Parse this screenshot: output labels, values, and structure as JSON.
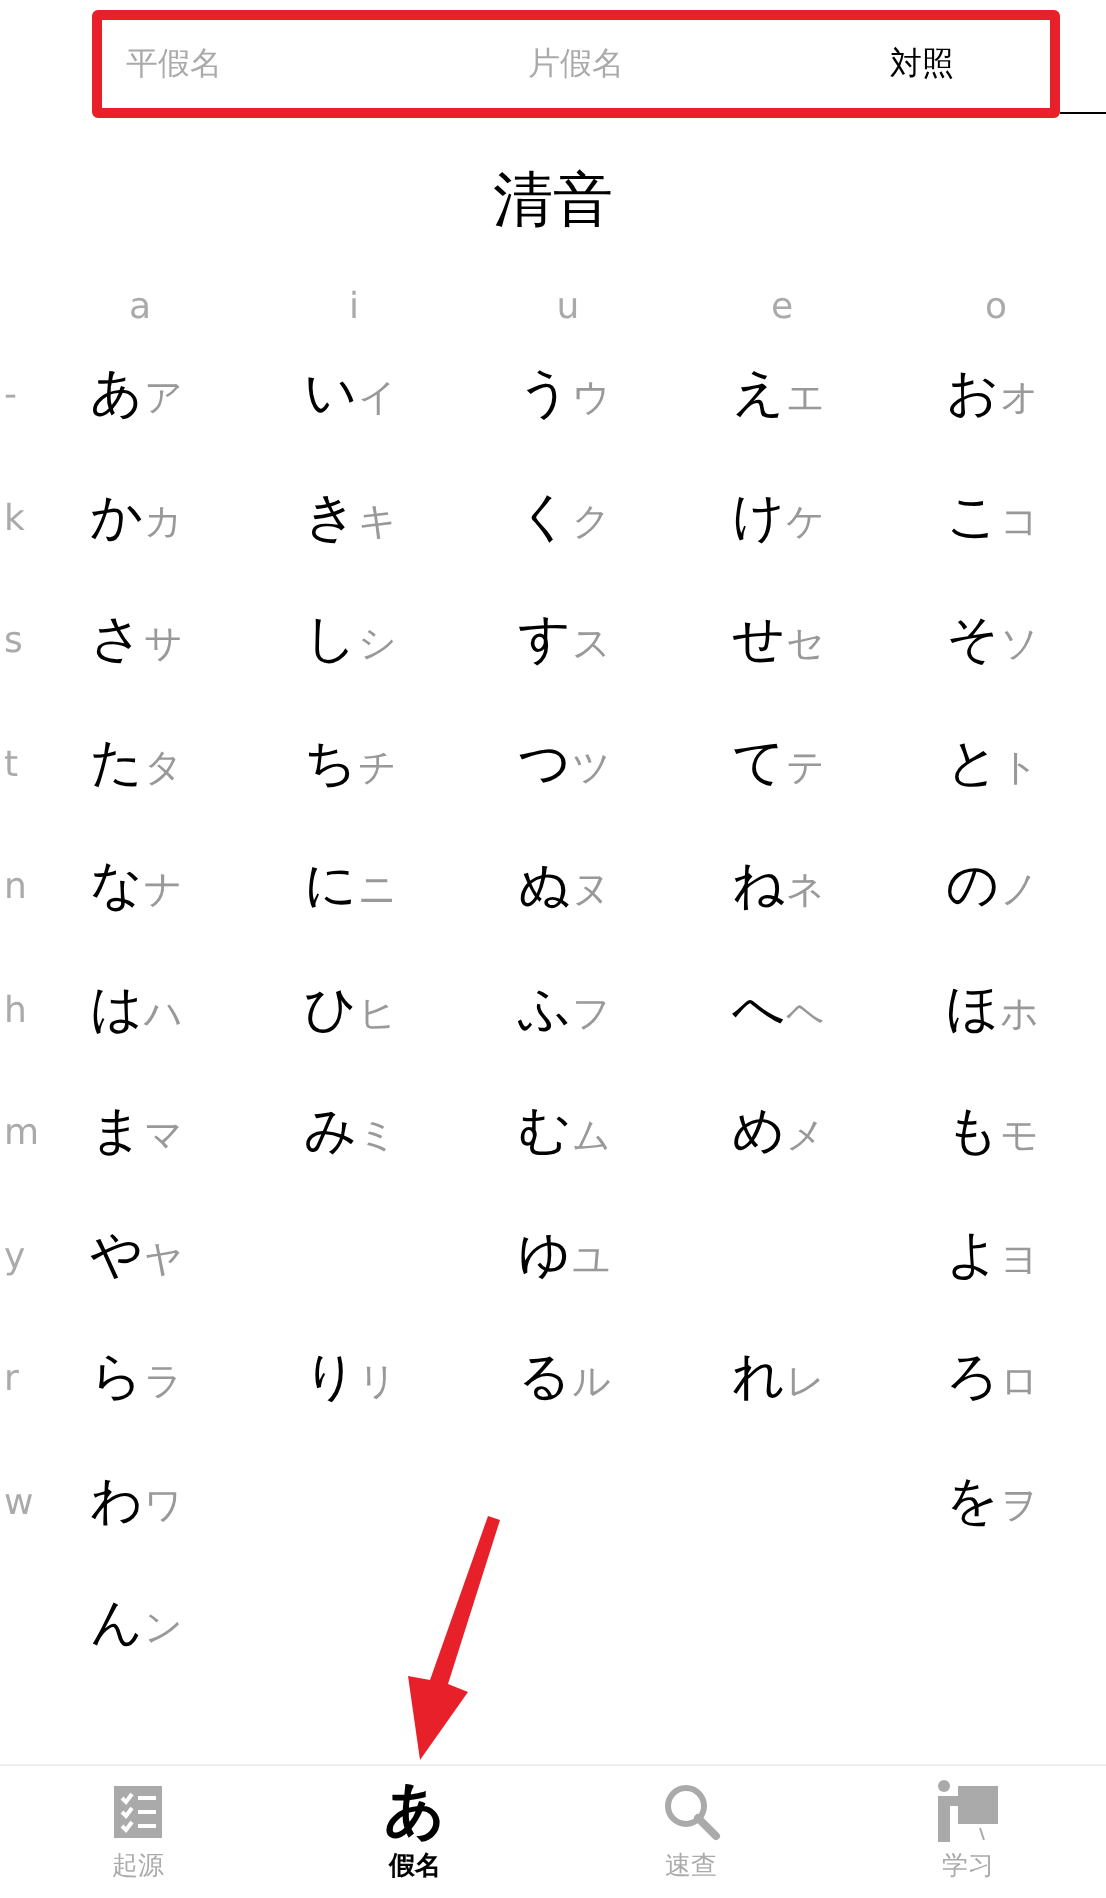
{
  "top_tabs": [
    {
      "label": "平假名",
      "selected": false
    },
    {
      "label": "片假名",
      "selected": false
    },
    {
      "label": "対照",
      "selected": true
    }
  ],
  "title": "清音",
  "vowels": [
    "a",
    "i",
    "u",
    "e",
    "o"
  ],
  "rows": [
    {
      "label": "-",
      "cells": [
        {
          "kind": "kana",
          "hiragana": "あ",
          "katakana": "ア"
        },
        {
          "kind": "kana",
          "hiragana": "い",
          "katakana": "イ"
        },
        {
          "kind": "kana",
          "hiragana": "う",
          "katakana": "ウ"
        },
        {
          "kind": "kana",
          "hiragana": "え",
          "katakana": "エ"
        },
        {
          "kind": "kana",
          "hiragana": "お",
          "katakana": "オ"
        }
      ]
    },
    {
      "label": "k",
      "cells": [
        {
          "kind": "kana",
          "hiragana": "か",
          "katakana": "カ"
        },
        {
          "kind": "kana",
          "hiragana": "き",
          "katakana": "キ"
        },
        {
          "kind": "kana",
          "hiragana": "く",
          "katakana": "ク"
        },
        {
          "kind": "kana",
          "hiragana": "け",
          "katakana": "ケ"
        },
        {
          "kind": "kana",
          "hiragana": "こ",
          "katakana": "コ"
        }
      ]
    },
    {
      "label": "s",
      "cells": [
        {
          "kind": "kana",
          "hiragana": "さ",
          "katakana": "サ"
        },
        {
          "kind": "kana",
          "hiragana": "し",
          "katakana": "シ"
        },
        {
          "kind": "kana",
          "hiragana": "す",
          "katakana": "ス"
        },
        {
          "kind": "kana",
          "hiragana": "せ",
          "katakana": "セ"
        },
        {
          "kind": "kana",
          "hiragana": "そ",
          "katakana": "ソ"
        }
      ]
    },
    {
      "label": "t",
      "cells": [
        {
          "kind": "kana",
          "hiragana": "た",
          "katakana": "タ"
        },
        {
          "kind": "kana",
          "hiragana": "ち",
          "katakana": "チ"
        },
        {
          "kind": "kana",
          "hiragana": "つ",
          "katakana": "ツ"
        },
        {
          "kind": "kana",
          "hiragana": "て",
          "katakana": "テ"
        },
        {
          "kind": "kana",
          "hiragana": "と",
          "katakana": "ト"
        }
      ]
    },
    {
      "label": "n",
      "cells": [
        {
          "kind": "kana",
          "hiragana": "な",
          "katakana": "ナ"
        },
        {
          "kind": "kana",
          "hiragana": "に",
          "katakana": "ニ"
        },
        {
          "kind": "kana",
          "hiragana": "ぬ",
          "katakana": "ヌ"
        },
        {
          "kind": "kana",
          "hiragana": "ね",
          "katakana": "ネ"
        },
        {
          "kind": "kana",
          "hiragana": "の",
          "katakana": "ノ"
        }
      ]
    },
    {
      "label": "h",
      "cells": [
        {
          "kind": "kana",
          "hiragana": "は",
          "katakana": "ハ"
        },
        {
          "kind": "kana",
          "hiragana": "ひ",
          "katakana": "ヒ"
        },
        {
          "kind": "kana",
          "hiragana": "ふ",
          "katakana": "フ"
        },
        {
          "kind": "kana",
          "hiragana": "へ",
          "katakana": "ヘ"
        },
        {
          "kind": "kana",
          "hiragana": "ほ",
          "katakana": "ホ"
        }
      ]
    },
    {
      "label": "m",
      "cells": [
        {
          "kind": "kana",
          "hiragana": "ま",
          "katakana": "マ"
        },
        {
          "kind": "kana",
          "hiragana": "み",
          "katakana": "ミ"
        },
        {
          "kind": "kana",
          "hiragana": "む",
          "katakana": "ム"
        },
        {
          "kind": "kana",
          "hiragana": "め",
          "katakana": "メ"
        },
        {
          "kind": "kana",
          "hiragana": "も",
          "katakana": "モ"
        }
      ]
    },
    {
      "label": "y",
      "cells": [
        {
          "kind": "kana",
          "hiragana": "や",
          "katakana": "ヤ"
        },
        {
          "kind": "blank"
        },
        {
          "kind": "kana",
          "hiragana": "ゆ",
          "katakana": "ユ"
        },
        {
          "kind": "blank"
        },
        {
          "kind": "kana",
          "hiragana": "よ",
          "katakana": "ヨ"
        }
      ]
    },
    {
      "label": "r",
      "cells": [
        {
          "kind": "kana",
          "hiragana": "ら",
          "katakana": "ラ"
        },
        {
          "kind": "kana",
          "hiragana": "り",
          "katakana": "リ"
        },
        {
          "kind": "kana",
          "hiragana": "る",
          "katakana": "ル"
        },
        {
          "kind": "kana",
          "hiragana": "れ",
          "katakana": "レ"
        },
        {
          "kind": "kana",
          "hiragana": "ろ",
          "katakana": "ロ"
        }
      ]
    },
    {
      "label": "w",
      "cells": [
        {
          "kind": "kana",
          "hiragana": "わ",
          "katakana": "ワ"
        },
        {
          "kind": "blank"
        },
        {
          "kind": "blank"
        },
        {
          "kind": "blank"
        },
        {
          "kind": "kana",
          "hiragana": "を",
          "katakana": "ヲ"
        }
      ]
    },
    {
      "cells": [
        {
          "kind": "kana",
          "hiragana": "ん",
          "katakana": "ン"
        }
      ]
    }
  ],
  "bottom_tabs": [
    {
      "kind": "checklist",
      "label": "起源",
      "selected": false
    },
    {
      "kind": "glyph",
      "glyph": "あ",
      "label": "假名",
      "selected": true
    },
    {
      "kind": "search",
      "label": "速查",
      "selected": false
    },
    {
      "kind": "teacher",
      "label": "学习",
      "selected": false
    }
  ]
}
